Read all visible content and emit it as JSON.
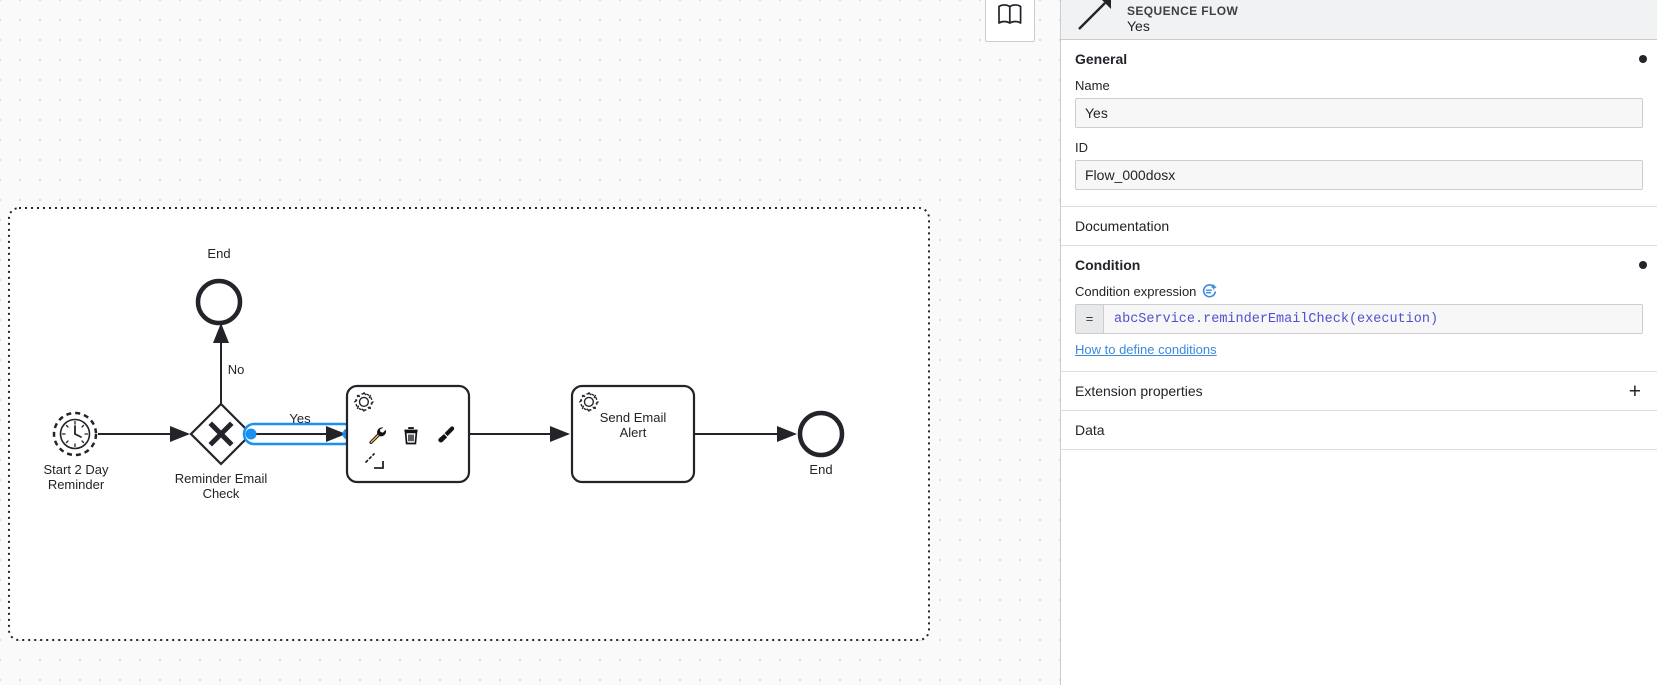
{
  "canvas": {
    "minimap_button_icon": "map-icon",
    "selection_color": "#1a90f0",
    "stroke_color": "#22242a",
    "participant_label": "",
    "elements": [
      {
        "id": "start-event",
        "type": "timer-start-event",
        "label": "Start 2 Day\nReminder"
      },
      {
        "id": "gateway",
        "type": "exclusive-gateway",
        "label": "Reminder Email\nCheck"
      },
      {
        "id": "end-event-top",
        "type": "end-event",
        "label": "End"
      },
      {
        "id": "service-task-1",
        "type": "service-task",
        "label": ""
      },
      {
        "id": "service-task-2",
        "type": "service-task",
        "label": "Send Email\nAlert"
      },
      {
        "id": "end-event-right",
        "type": "end-event",
        "label": "End"
      }
    ],
    "flows": [
      {
        "id": "flow-start-gateway",
        "label": "",
        "selected": false
      },
      {
        "id": "flow-no",
        "label": "No",
        "selected": false
      },
      {
        "id": "flow-yes",
        "label": "Yes",
        "selected": true
      },
      {
        "id": "flow-task-task",
        "label": "",
        "selected": false
      },
      {
        "id": "flow-task-end",
        "label": "",
        "selected": false
      }
    ],
    "context_pad": {
      "items": [
        {
          "icon": "wrench-icon",
          "name": "change-type"
        },
        {
          "icon": "trash-icon",
          "name": "delete"
        },
        {
          "icon": "paintbrush-icon",
          "name": "set-color"
        },
        {
          "icon": "corner-icon",
          "name": "append-element"
        }
      ]
    }
  },
  "panel": {
    "header": {
      "type": "SEQUENCE FLOW",
      "name": "Yes",
      "icon": "sequence-flow-arrow-icon"
    },
    "groups": [
      {
        "title": "General",
        "bold": true,
        "has_dot": true,
        "fields": [
          {
            "label": "Name",
            "value": "Yes",
            "name": "name-field"
          },
          {
            "label": "ID",
            "value": "Flow_000dosx",
            "name": "id-field"
          }
        ]
      },
      {
        "title": "Documentation",
        "bold": false,
        "has_dot": false
      },
      {
        "title": "Condition",
        "bold": true,
        "has_dot": true,
        "expression": {
          "label": "Condition expression",
          "label_icon": "expression-toggle-icon",
          "prefix": "=",
          "value": "abcService.reminderEmailCheck(execution)",
          "help_link": "How to define conditions"
        }
      },
      {
        "title": "Extension properties",
        "bold": false,
        "has_dot": false,
        "add_label": "+"
      },
      {
        "title": "Data",
        "bold": false,
        "has_dot": false
      }
    ]
  }
}
